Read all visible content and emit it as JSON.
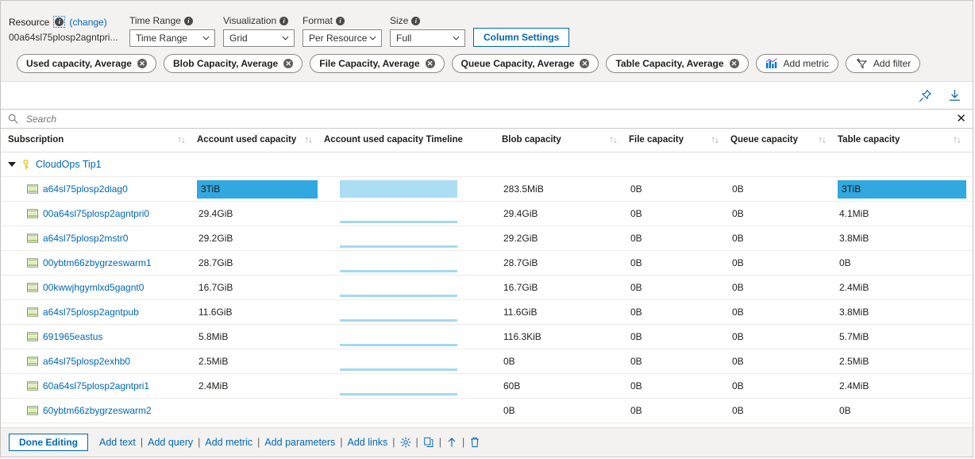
{
  "config": {
    "resource": {
      "label": "Resource",
      "change_link": "(change)",
      "value": "00a64sl75plosp2agntpri..."
    },
    "time_range": {
      "label": "Time Range",
      "value": "Time Range"
    },
    "visualization": {
      "label": "Visualization",
      "value": "Grid"
    },
    "format": {
      "label": "Format",
      "value": "Per Resource"
    },
    "size": {
      "label": "Size",
      "value": "Full"
    },
    "column_settings_label": "Column Settings"
  },
  "chips": [
    {
      "label": "Used capacity, Average",
      "removable": true
    },
    {
      "label": "Blob Capacity, Average",
      "removable": true
    },
    {
      "label": "File Capacity, Average",
      "removable": true
    },
    {
      "label": "Queue Capacity, Average",
      "removable": true
    },
    {
      "label": "Table Capacity, Average",
      "removable": true
    },
    {
      "label": "Add metric",
      "removable": false
    },
    {
      "label": "Add filter",
      "removable": false
    }
  ],
  "toolbar": {
    "pin_icon": "pin-icon",
    "download_icon": "download-icon"
  },
  "search": {
    "placeholder": "Search",
    "value": "",
    "clear_label": "✕"
  },
  "table": {
    "columns": [
      {
        "label": "Subscription",
        "sortable": true
      },
      {
        "label": "Account used capacity",
        "sortable": true
      },
      {
        "label": "Account used capacity Timeline",
        "sortable": false
      },
      {
        "label": "Blob capacity",
        "sortable": true
      },
      {
        "label": "File capacity",
        "sortable": true
      },
      {
        "label": "Queue capacity",
        "sortable": true
      },
      {
        "label": "Table capacity",
        "sortable": true
      }
    ],
    "group": {
      "name": "CloudOps Tip1",
      "expanded": true
    },
    "rows": [
      {
        "name": "a64sl75plosp2diag0",
        "used": "3TiB",
        "used_bar": 100,
        "used_highlight": true,
        "timeline": "block",
        "blob": "283.5MiB",
        "file": "0B",
        "queue": "0B",
        "table": "3TiB",
        "table_highlight": true
      },
      {
        "name": "00a64sl75plosp2agntpri0",
        "used": "29.4GiB",
        "used_bar": 0,
        "used_highlight": false,
        "timeline": "line",
        "blob": "29.4GiB",
        "file": "0B",
        "queue": "0B",
        "table": "4.1MiB",
        "table_highlight": false
      },
      {
        "name": "a64sl75plosp2mstr0",
        "used": "29.2GiB",
        "used_bar": 0,
        "used_highlight": false,
        "timeline": "line",
        "blob": "29.2GiB",
        "file": "0B",
        "queue": "0B",
        "table": "3.8MiB",
        "table_highlight": false
      },
      {
        "name": "00ybtm66zbygrzeswarm1",
        "used": "28.7GiB",
        "used_bar": 0,
        "used_highlight": false,
        "timeline": "line",
        "blob": "28.7GiB",
        "file": "0B",
        "queue": "0B",
        "table": "0B",
        "table_highlight": false
      },
      {
        "name": "00kwwjhgymlxd5gagnt0",
        "used": "16.7GiB",
        "used_bar": 0,
        "used_highlight": false,
        "timeline": "line",
        "blob": "16.7GiB",
        "file": "0B",
        "queue": "0B",
        "table": "2.4MiB",
        "table_highlight": false
      },
      {
        "name": "a64sl75plosp2agntpub",
        "used": "11.6GiB",
        "used_bar": 0,
        "used_highlight": false,
        "timeline": "line",
        "blob": "11.6GiB",
        "file": "0B",
        "queue": "0B",
        "table": "3.8MiB",
        "table_highlight": false
      },
      {
        "name": "691965eastus",
        "used": "5.8MiB",
        "used_bar": 0,
        "used_highlight": false,
        "timeline": "line",
        "blob": "116.3KiB",
        "file": "0B",
        "queue": "0B",
        "table": "5.7MiB",
        "table_highlight": false
      },
      {
        "name": "a64sl75plosp2exhb0",
        "used": "2.5MiB",
        "used_bar": 0,
        "used_highlight": false,
        "timeline": "line",
        "blob": "0B",
        "file": "0B",
        "queue": "0B",
        "table": "2.5MiB",
        "table_highlight": false
      },
      {
        "name": "60a64sl75plosp2agntpri1",
        "used": "2.4MiB",
        "used_bar": 0,
        "used_highlight": false,
        "timeline": "line",
        "blob": "60B",
        "file": "0B",
        "queue": "0B",
        "table": "2.4MiB",
        "table_highlight": false
      },
      {
        "name": "60ybtm66zbygrzeswarm2",
        "used": "",
        "used_bar": 0,
        "used_highlight": false,
        "timeline": "none",
        "blob": "0B",
        "file": "0B",
        "queue": "0B",
        "table": "0B",
        "table_highlight": false
      }
    ]
  },
  "footer": {
    "done_label": "Done Editing",
    "links": [
      "Add text",
      "Add query",
      "Add metric",
      "Add parameters",
      "Add links"
    ],
    "separator": "|",
    "icons": [
      "gear-icon",
      "copy-icon",
      "move-up-icon",
      "delete-icon"
    ]
  },
  "colors": {
    "accent_blue": "#0067b8",
    "bar_blue": "#31A8E0",
    "timeline_blue": "#ABDDF5",
    "chrome_gray": "#f3f2f1"
  }
}
